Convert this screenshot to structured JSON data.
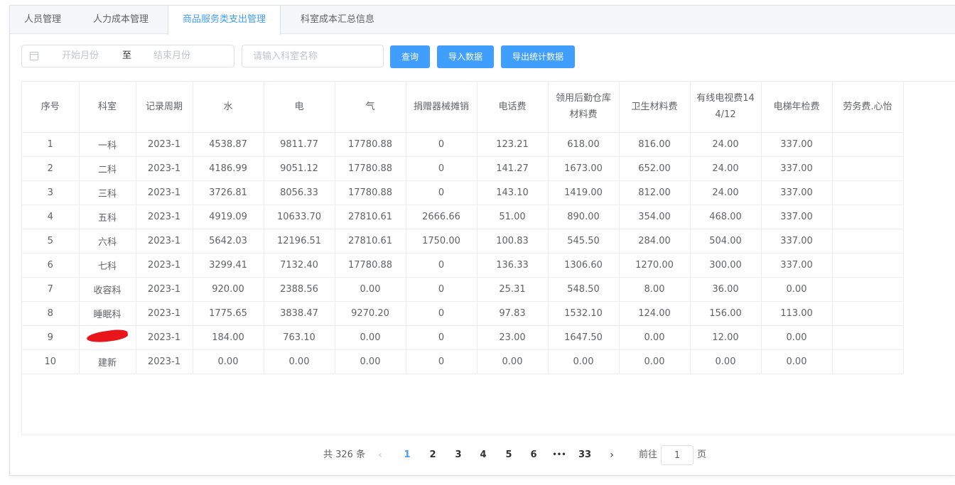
{
  "tabs": [
    {
      "label": "人员管理",
      "active": false
    },
    {
      "label": "人力成本管理",
      "active": false
    },
    {
      "label": "商品服务类支出管理",
      "active": true
    },
    {
      "label": "科室成本汇总信息",
      "active": false
    }
  ],
  "filters": {
    "start_placeholder": "开始月份",
    "range_separator": "至",
    "end_placeholder": "结束月份",
    "dept_placeholder": "请输入科室名称",
    "calendar_icon": "calendar-icon"
  },
  "buttons": {
    "query": "查询",
    "import": "导入数据",
    "export": "导出统计数据"
  },
  "accent_color": "#409eff",
  "redaction_color": "#e8151a",
  "table": {
    "headers": [
      "序号",
      "科室",
      "记录周期",
      "水",
      "电",
      "气",
      "捐赠器械摊销",
      "电话费",
      "领用后勤仓库材料费",
      "卫生材料费",
      "有线电视费144/12",
      "电梯年检费",
      "劳务费.心怡"
    ],
    "rows": [
      [
        "1",
        "一科",
        "2023-1",
        "4538.87",
        "9811.77",
        "17780.88",
        "0",
        "123.21",
        "618.00",
        "816.00",
        "24.00",
        "337.00",
        ""
      ],
      [
        "2",
        "二科",
        "2023-1",
        "4186.99",
        "9051.12",
        "17780.88",
        "0",
        "141.27",
        "1673.00",
        "652.00",
        "24.00",
        "337.00",
        ""
      ],
      [
        "3",
        "三科",
        "2023-1",
        "3726.81",
        "8056.33",
        "17780.88",
        "0",
        "143.10",
        "1419.00",
        "812.00",
        "24.00",
        "337.00",
        ""
      ],
      [
        "4",
        "五科",
        "2023-1",
        "4919.09",
        "10633.70",
        "27810.61",
        "2666.66",
        "51.00",
        "890.00",
        "354.00",
        "468.00",
        "337.00",
        ""
      ],
      [
        "5",
        "六科",
        "2023-1",
        "5642.03",
        "12196.51",
        "27810.61",
        "1750.00",
        "100.83",
        "545.50",
        "284.00",
        "504.00",
        "337.00",
        ""
      ],
      [
        "6",
        "七科",
        "2023-1",
        "3299.41",
        "7132.40",
        "17780.88",
        "0",
        "136.33",
        "1306.60",
        "1270.00",
        "300.00",
        "337.00",
        ""
      ],
      [
        "7",
        "收容科",
        "2023-1",
        "920.00",
        "2388.56",
        "0.00",
        "0",
        "25.31",
        "548.50",
        "8.00",
        "36.00",
        "0.00",
        ""
      ],
      [
        "8",
        "睡眠科",
        "2023-1",
        "1775.65",
        "3838.47",
        "9270.20",
        "0",
        "97.83",
        "1532.10",
        "124.00",
        "156.00",
        "113.00",
        ""
      ],
      [
        "9",
        "",
        "2023-1",
        "184.00",
        "763.10",
        "0.00",
        "0",
        "23.00",
        "1647.50",
        "0.00",
        "12.00",
        "0.00",
        ""
      ],
      [
        "10",
        "建新",
        "2023-1",
        "0.00",
        "0.00",
        "0.00",
        "0",
        "0.00",
        "0.00",
        "0.00",
        "0.00",
        "0.00",
        ""
      ]
    ],
    "redacted_cell": {
      "row": 8,
      "col": 1
    }
  },
  "pagination": {
    "total_text": "共 326 条",
    "prev_icon": "chevron-left-icon",
    "pages": [
      "1",
      "2",
      "3",
      "4",
      "5",
      "6",
      "•••",
      "33"
    ],
    "current_page": "1",
    "next_icon": "chevron-right-icon",
    "goto_label": "前往",
    "goto_value": "1",
    "page_unit": "页"
  }
}
